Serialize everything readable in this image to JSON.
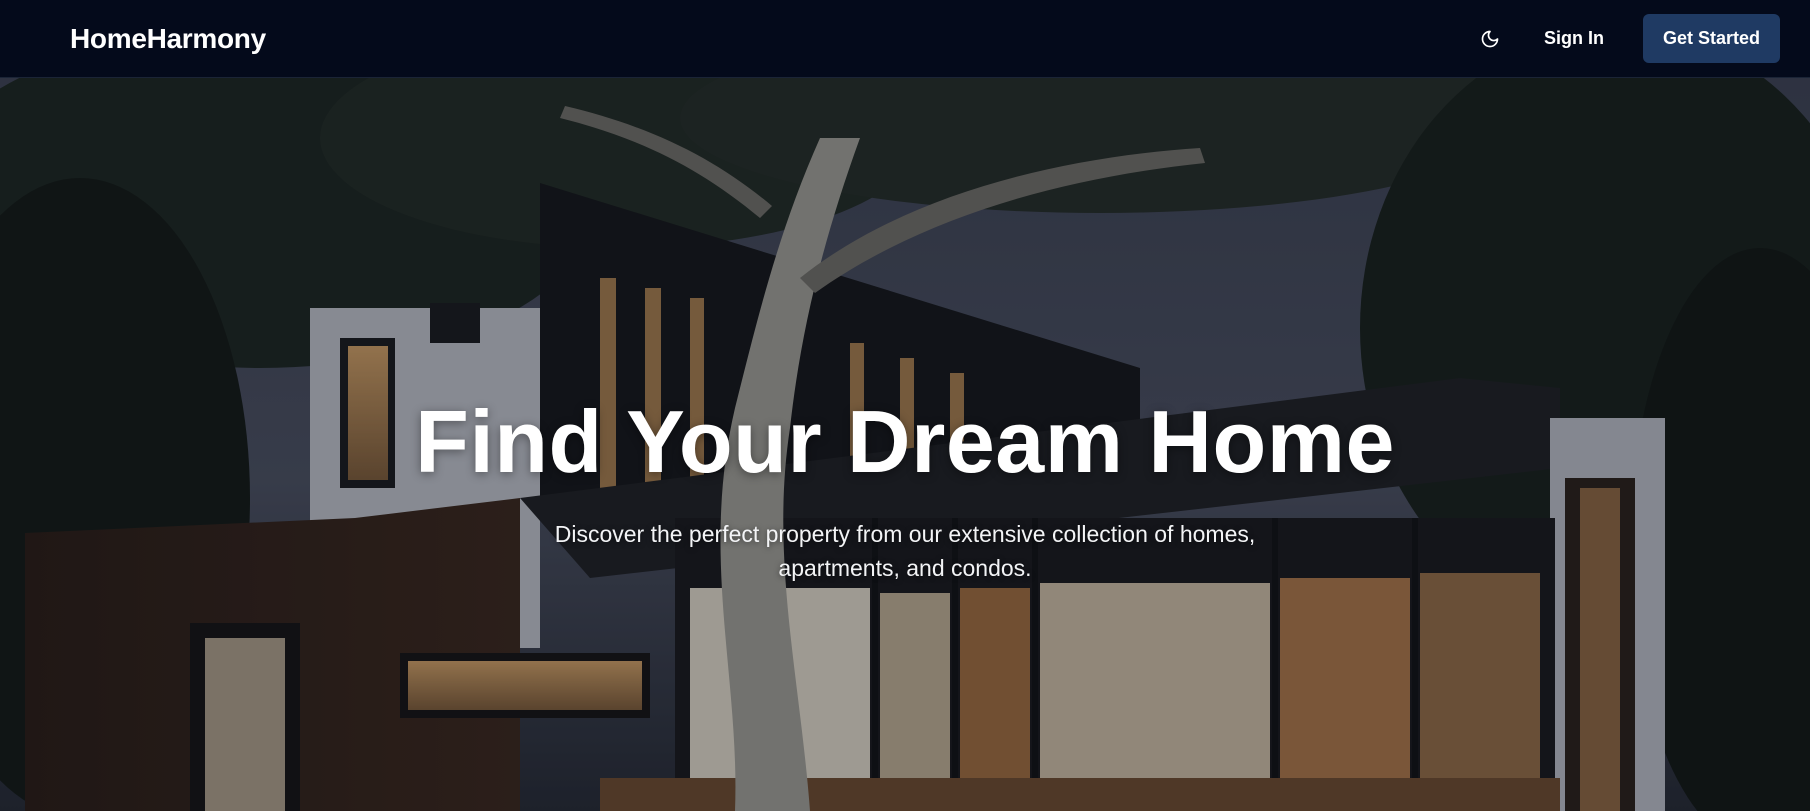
{
  "header": {
    "brand": "HomeHarmony",
    "theme_toggle_icon": "moon-icon",
    "sign_in_label": "Sign In",
    "get_started_label": "Get Started",
    "colors": {
      "background": "#040a1b",
      "cta_background": "#1f3a63"
    }
  },
  "hero": {
    "title": "Find Your Dream Home",
    "subtitle": "Discover the perfect property from our extensive collection of homes, apartments, and condos.",
    "background_image": "modern-house-at-dusk-photo"
  }
}
